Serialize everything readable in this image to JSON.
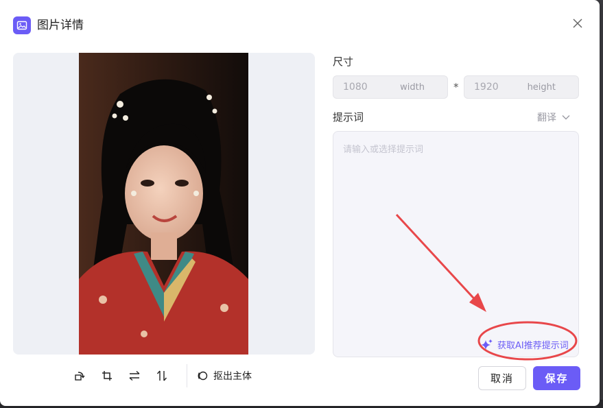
{
  "dialog": {
    "title": "图片详情",
    "close_icon": "close-icon"
  },
  "toolbar": {
    "tools": [
      {
        "name": "rotate-icon"
      },
      {
        "name": "crop-icon"
      },
      {
        "name": "flip-horizontal-icon"
      },
      {
        "name": "flip-vertical-icon"
      }
    ],
    "extract_label": "抠出主体"
  },
  "size": {
    "label": "尺寸",
    "width_value": "1080",
    "width_unit": "width",
    "separator": "*",
    "height_value": "1920",
    "height_unit": "height"
  },
  "prompt": {
    "label": "提示词",
    "translate_label": "翻译",
    "placeholder": "请输入或选择提示词",
    "value": "",
    "ai_label": "获取AI推荐提示词"
  },
  "actions": {
    "cancel_label": "取消",
    "save_label": "保存"
  },
  "colors": {
    "accent": "#6b5cf6",
    "annotation": "#e8474a"
  }
}
